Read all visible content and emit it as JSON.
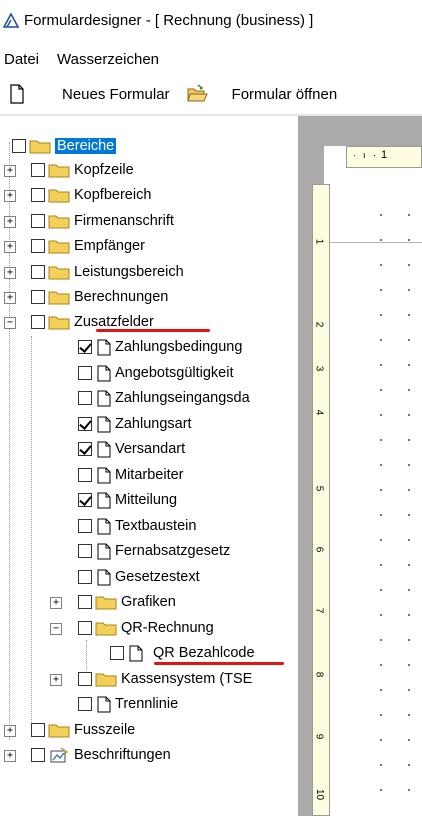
{
  "window": {
    "title": "Formulardesigner - [ Rechnung (business) ]"
  },
  "menu": [
    "Datei",
    "Wasserzeichen"
  ],
  "toolbar": {
    "new_form": "Neues Formular",
    "open_form": "Formular öffnen"
  },
  "tree": {
    "root": "Bereiche",
    "items": [
      {
        "label": "Kopfzeile"
      },
      {
        "label": "Kopfbereich"
      },
      {
        "label": "Firmenanschrift"
      },
      {
        "label": "Empfänger"
      },
      {
        "label": "Leistungsbereich"
      },
      {
        "label": "Berechnungen"
      },
      {
        "label": "Zusatzfelder"
      }
    ],
    "zusatzfelder": [
      {
        "label": "Zahlungsbedingung",
        "checked": true
      },
      {
        "label": "Angebotsgültigkeit",
        "checked": false
      },
      {
        "label": "Zahlungseingangsda",
        "checked": false
      },
      {
        "label": "Zahlungsart",
        "checked": true
      },
      {
        "label": "Versandart",
        "checked": true
      },
      {
        "label": "Mitarbeiter",
        "checked": false
      },
      {
        "label": "Mitteilung",
        "checked": true
      },
      {
        "label": "Textbaustein",
        "checked": false
      },
      {
        "label": "Fernabsatzgesetz",
        "checked": false
      },
      {
        "label": "Gesetzestext",
        "checked": false
      },
      {
        "label": "Grafiken"
      },
      {
        "label": "QR-Rechnung"
      },
      {
        "label": "QR Bezahlcode",
        "checked": false
      },
      {
        "label": "Kassensystem (TSE"
      },
      {
        "label": "Trennlinie"
      }
    ],
    "bottom": [
      {
        "label": "Fusszeile"
      },
      {
        "label": "Beschriftungen"
      }
    ]
  },
  "ruler": {
    "horizontal_number": "1",
    "vertical_numbers": [
      "1",
      "2",
      "3",
      "4",
      "5",
      "6",
      "7",
      "8",
      "9",
      "10"
    ]
  },
  "colors": {
    "selection": "#0078d7",
    "highlight_underline": "#e01414",
    "ruler": "#fffde0",
    "designer_bg": "#aaaaaa"
  }
}
